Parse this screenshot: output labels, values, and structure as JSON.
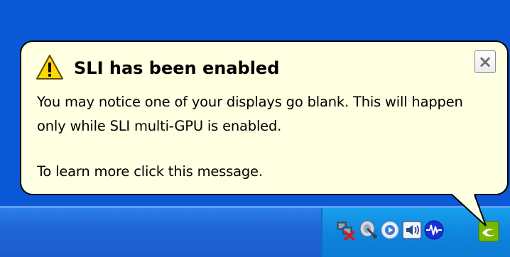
{
  "balloon": {
    "title": "SLI has been enabled",
    "close_symbol": "×",
    "message_line1": "You may notice one of your displays go blank. This will happen",
    "message_line2": "only while SLI multi-GPU is enabled.",
    "message_line3": "To learn more click this message.",
    "icon": "warning-icon"
  },
  "tray": {
    "icons": [
      "network-disconnected-icon",
      "satellite-dish-icon",
      "media-player-icon",
      "volume-speaker-icon",
      "audio-waveform-icon",
      "nvidia-icon"
    ]
  },
  "colors": {
    "desktop": "#0a58d6",
    "taskbar": "#1f68d8",
    "tray": "#0f86de",
    "balloon_bg": "#ffffe1"
  }
}
